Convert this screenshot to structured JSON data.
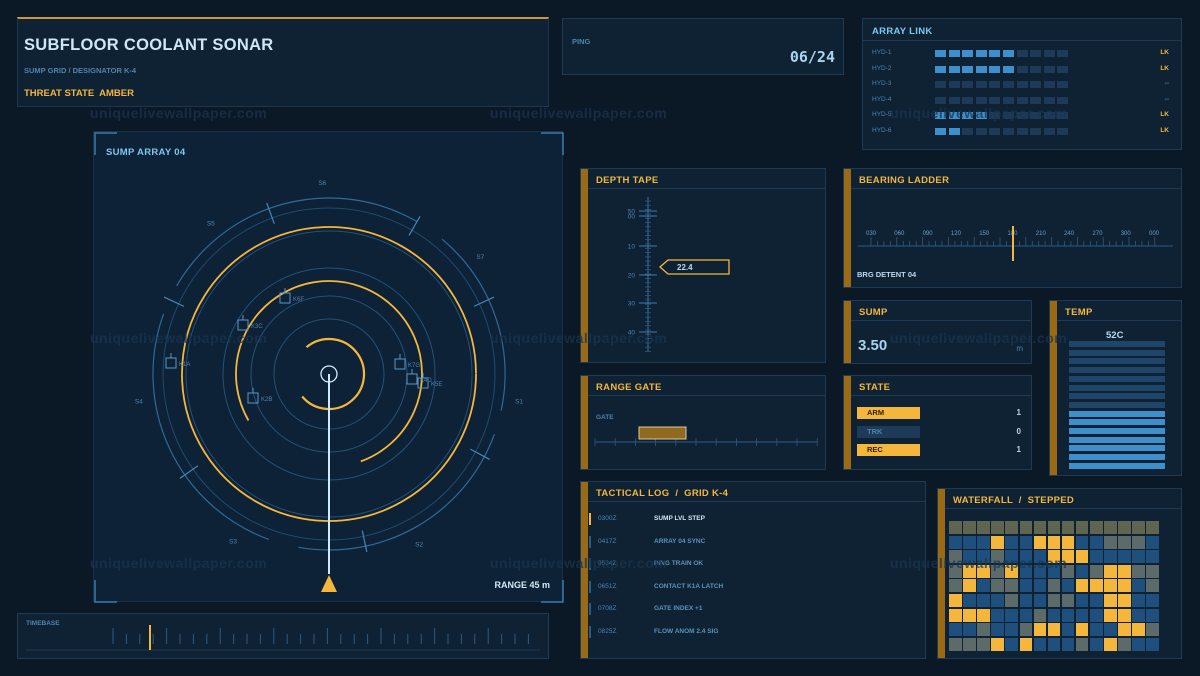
{
  "header": {
    "title": "SUBFLOOR COOLANT SONAR",
    "subtitle": "SUMP GRID / DESIGNATOR K-4",
    "threat": "THREAT STATE  AMBER"
  },
  "ping": {
    "label": "PING",
    "value": "06/24"
  },
  "array_link": {
    "title": "ARRAY LINK",
    "rows": [
      {
        "name": "HYD-1",
        "status": "LK",
        "level": 6
      },
      {
        "name": "HYD-2",
        "status": "LK",
        "level": 6
      },
      {
        "name": "HYD-3",
        "status": "--",
        "level": 0
      },
      {
        "name": "HYD-4",
        "status": "--",
        "level": 0
      },
      {
        "name": "HYD-5",
        "status": "LK",
        "level": 4
      },
      {
        "name": "HYD-6",
        "status": "LK",
        "level": 2
      }
    ]
  },
  "sonar": {
    "title": "SUMP ARRAY 04",
    "range": "RANGE 45 m",
    "sectors": [
      "S1",
      "S2",
      "S3",
      "S4",
      "S5",
      "S6",
      "S7"
    ],
    "contacts": [
      "K1A",
      "K2B",
      "K3C",
      "K5E",
      "K6F",
      "K7G",
      "K4D"
    ]
  },
  "timebase": {
    "label": "TIMEBASE"
  },
  "depth": {
    "title": "DEPTH TAPE",
    "ticks": [
      "50",
      "00",
      "10",
      "20",
      "30",
      "40"
    ],
    "value": "22.4"
  },
  "bearing": {
    "title": "BEARING LADDER",
    "ticks": [
      "030",
      "060",
      "090",
      "120",
      "150",
      "180",
      "210",
      "240",
      "270",
      "300",
      "000"
    ],
    "caption": "BRG DETENT 04"
  },
  "range_gate": {
    "title": "RANGE GATE",
    "label": "GATE"
  },
  "sump": {
    "title": "SUMP",
    "value": "3.50",
    "unit": "m"
  },
  "state": {
    "title": "STATE",
    "rows": [
      {
        "label": "ARM",
        "value": "1",
        "active": true
      },
      {
        "label": "TRK",
        "value": "0",
        "active": false
      },
      {
        "label": "REC",
        "value": "1",
        "active": true
      }
    ]
  },
  "temp": {
    "title": "TEMP",
    "value": "52C",
    "level": 0.45
  },
  "log": {
    "title": "TACTICAL LOG  /  GRID K-4",
    "rows": [
      {
        "time": "0300Z",
        "msg": "SUMP LVL STEP"
      },
      {
        "time": "0417Z",
        "msg": "ARRAY 04 SYNC"
      },
      {
        "time": "0534Z",
        "msg": "PING TRAIN OK"
      },
      {
        "time": "0651Z",
        "msg": "CONTACT K1A LATCH"
      },
      {
        "time": "0708Z",
        "msg": "GATE INDEX +1"
      },
      {
        "time": "0825Z",
        "msg": "FLOW ANOM 2.4 SIG"
      }
    ]
  },
  "waterfall": {
    "title": "WATERFALL  /  STEPPED",
    "grid": [
      "CCCCCCCCCCCCCCC",
      "BBBABBAAABBCCCB",
      "CBBCBBBAAABBBBB",
      "CAACABBBCBCAACC",
      "CABCCBBCBAAAABC",
      "ABBBCBBCCBBAABB",
      "AAABBBCBBBBAABB",
      "BBCBBCAABABBAAC",
      "CCCABABBBCBACBB"
    ]
  },
  "watermark": "uniquelivewallpaper.com",
  "colors": {
    "amber": "#f5b63c",
    "blue": "#7fc6ef",
    "panel": "#0e2234",
    "background": "#0b1825"
  }
}
